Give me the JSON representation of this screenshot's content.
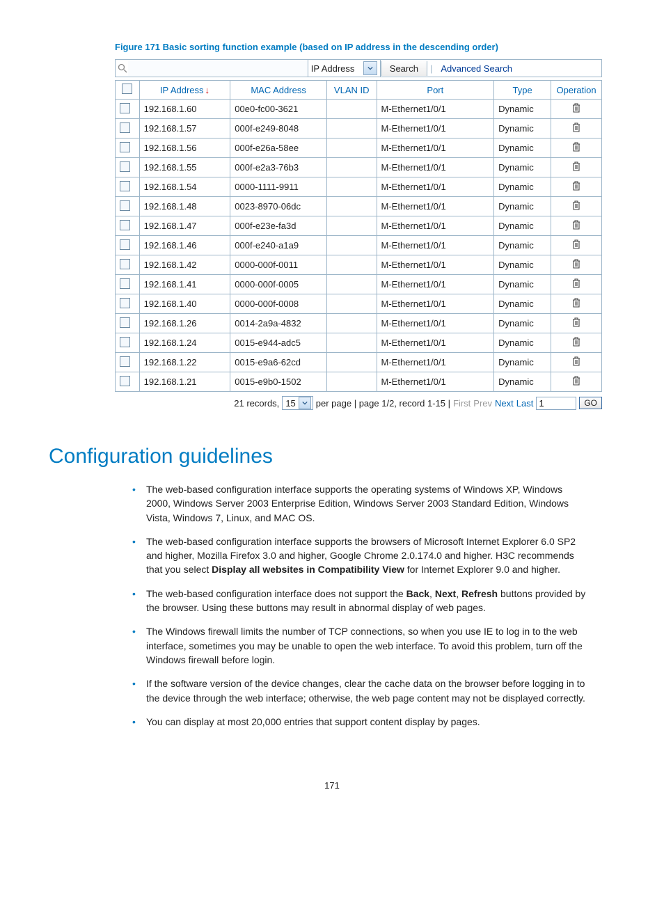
{
  "figure_caption": "Figure 171 Basic sorting function example (based on IP address in the descending order)",
  "search": {
    "field_selected": "IP Address",
    "button": "Search",
    "advanced": "Advanced Search"
  },
  "table": {
    "headers": {
      "ip": "IP Address",
      "mac": "MAC Address",
      "vlan": "VLAN ID",
      "port": "Port",
      "type": "Type",
      "operation": "Operation"
    },
    "rows": [
      {
        "ip": "192.168.1.60",
        "mac": "00e0-fc00-3621",
        "vlan": "",
        "port": "M-Ethernet1/0/1",
        "type": "Dynamic"
      },
      {
        "ip": "192.168.1.57",
        "mac": "000f-e249-8048",
        "vlan": "",
        "port": "M-Ethernet1/0/1",
        "type": "Dynamic"
      },
      {
        "ip": "192.168.1.56",
        "mac": "000f-e26a-58ee",
        "vlan": "",
        "port": "M-Ethernet1/0/1",
        "type": "Dynamic"
      },
      {
        "ip": "192.168.1.55",
        "mac": "000f-e2a3-76b3",
        "vlan": "",
        "port": "M-Ethernet1/0/1",
        "type": "Dynamic"
      },
      {
        "ip": "192.168.1.54",
        "mac": "0000-1111-9911",
        "vlan": "",
        "port": "M-Ethernet1/0/1",
        "type": "Dynamic"
      },
      {
        "ip": "192.168.1.48",
        "mac": "0023-8970-06dc",
        "vlan": "",
        "port": "M-Ethernet1/0/1",
        "type": "Dynamic"
      },
      {
        "ip": "192.168.1.47",
        "mac": "000f-e23e-fa3d",
        "vlan": "",
        "port": "M-Ethernet1/0/1",
        "type": "Dynamic"
      },
      {
        "ip": "192.168.1.46",
        "mac": "000f-e240-a1a9",
        "vlan": "",
        "port": "M-Ethernet1/0/1",
        "type": "Dynamic"
      },
      {
        "ip": "192.168.1.42",
        "mac": "0000-000f-0011",
        "vlan": "",
        "port": "M-Ethernet1/0/1",
        "type": "Dynamic"
      },
      {
        "ip": "192.168.1.41",
        "mac": "0000-000f-0005",
        "vlan": "",
        "port": "M-Ethernet1/0/1",
        "type": "Dynamic"
      },
      {
        "ip": "192.168.1.40",
        "mac": "0000-000f-0008",
        "vlan": "",
        "port": "M-Ethernet1/0/1",
        "type": "Dynamic"
      },
      {
        "ip": "192.168.1.26",
        "mac": "0014-2a9a-4832",
        "vlan": "",
        "port": "M-Ethernet1/0/1",
        "type": "Dynamic"
      },
      {
        "ip": "192.168.1.24",
        "mac": "0015-e944-adc5",
        "vlan": "",
        "port": "M-Ethernet1/0/1",
        "type": "Dynamic"
      },
      {
        "ip": "192.168.1.22",
        "mac": "0015-e9a6-62cd",
        "vlan": "",
        "port": "M-Ethernet1/0/1",
        "type": "Dynamic"
      },
      {
        "ip": "192.168.1.21",
        "mac": "0015-e9b0-1502",
        "vlan": "",
        "port": "M-Ethernet1/0/1",
        "type": "Dynamic"
      }
    ]
  },
  "pager": {
    "records_prefix": "21 records,",
    "per_page_value": "15",
    "per_page_suffix": "per page | page 1/2, record 1-15 |",
    "first": "First",
    "prev": "Prev",
    "next": "Next",
    "last": "Last",
    "page_input": "1",
    "go": "GO"
  },
  "section_heading": "Configuration guidelines",
  "bullets": [
    "The web-based configuration interface supports the operating systems of Windows XP, Windows 2000, Windows Server 2003 Enterprise Edition, Windows Server 2003 Standard Edition, Windows Vista, Windows 7, Linux, and MAC OS.",
    "The web-based configuration interface supports the browsers of Microsoft Internet Explorer 6.0 SP2 and higher, Mozilla Firefox 3.0 and higher, Google Chrome 2.0.174.0 and higher. H3C recommends that you select <b>Display all websites in Compatibility View</b> for Internet Explorer 9.0 and higher.",
    "The web-based configuration interface does not support the <b>Back</b>, <b>Next</b>, <b>Refresh</b> buttons provided by the browser. Using these buttons may result in abnormal display of web pages.",
    "The Windows firewall limits the number of TCP connections, so when you use IE to log in to the web interface, sometimes you may be unable to open the web interface. To avoid this problem, turn off the Windows firewall before login.",
    "If the software version of the device changes, clear the cache data on the browser before logging in to the device through the web interface; otherwise, the web page content may not be displayed correctly.",
    "You can display at most 20,000 entries that support content display by pages."
  ],
  "page_number": "171"
}
